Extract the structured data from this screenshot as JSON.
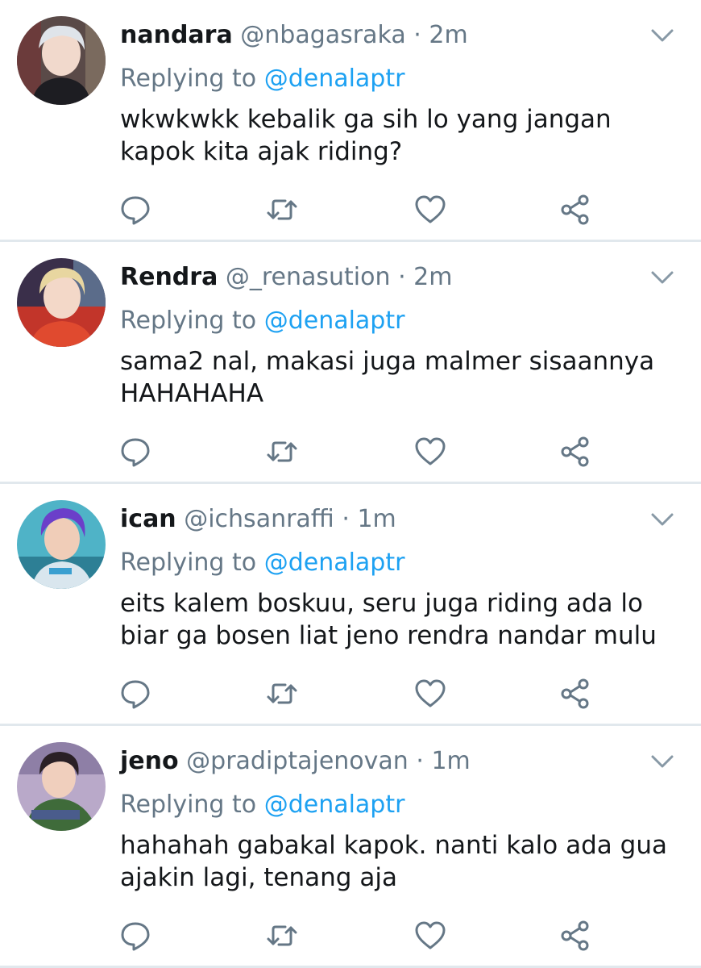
{
  "reply_prefix": "Replying to",
  "icons": {
    "reply": "reply-icon",
    "retweet": "retweet-icon",
    "like": "heart-icon",
    "share": "share-icon",
    "menu": "chevron-down-icon"
  },
  "colors": {
    "mention": "#1da1f2",
    "secondary_text": "#657786",
    "icon": "#657786",
    "divider": "#e1e8ed"
  },
  "tweets": [
    {
      "name": "nandara",
      "handle": "@nbagasraka",
      "separator": "·",
      "time": "2m",
      "reply_to": "@denalaptr",
      "text": "wkwkwkk kebalik ga sih lo yang jangan kapok kita ajak riding?"
    },
    {
      "name": "Rendra",
      "handle": "@_renasution",
      "separator": "·",
      "time": "2m",
      "reply_to": "@denalaptr",
      "text": "sama2 nal, makasi juga malmer sisaannya HAHAHAHA"
    },
    {
      "name": "ican",
      "handle": "@ichsanraffi",
      "separator": "·",
      "time": "1m",
      "reply_to": "@denalaptr",
      "text": "eits kalem boskuu, seru juga riding ada lo biar ga bosen liat jeno rendra nandar mulu"
    },
    {
      "name": "jeno",
      "handle": "@pradiptajenovan",
      "separator": "·",
      "time": "1m",
      "reply_to": "@denalaptr",
      "text": "hahahah gabakal kapok. nanti kalo ada gua ajakin lagi, tenang aja"
    }
  ]
}
